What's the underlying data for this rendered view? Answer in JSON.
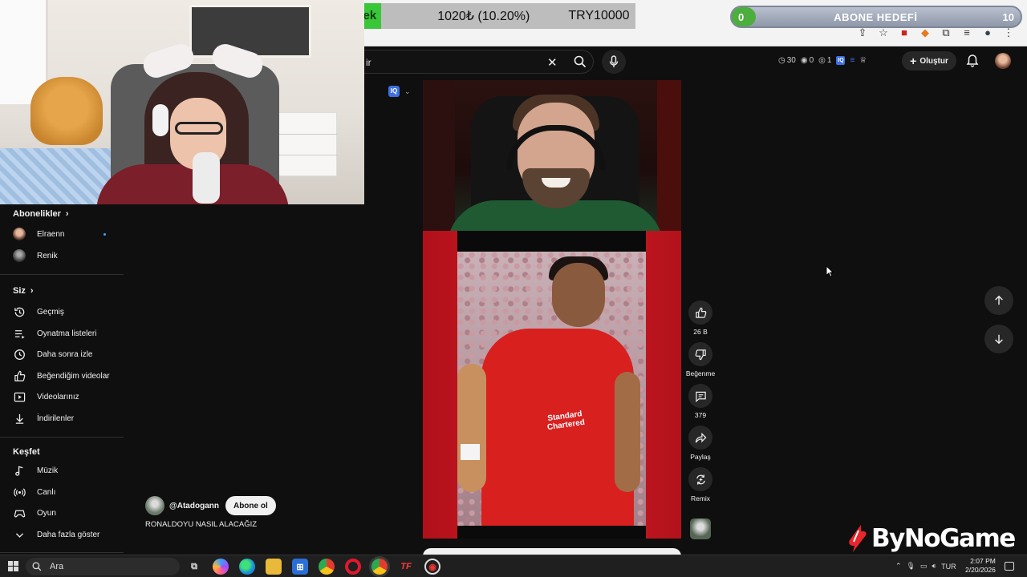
{
  "overlays": {
    "donation": {
      "tag": "Destek",
      "amount": "1020₺ (10.20%)",
      "goal": "TRY10000"
    },
    "sub_goal": {
      "start": "0",
      "label": "ABONE HEDEFİ",
      "end": "10",
      "progress": 0.05
    },
    "watermark": "ByNoGame"
  },
  "search": {
    "query": "ir"
  },
  "stats": {
    "views": "30",
    "watching": "0",
    "other": "1"
  },
  "header": {
    "create_label": "Oluştur"
  },
  "sidebar": {
    "subscriptions_title": "Abonelikler",
    "subscriptions": [
      {
        "label": "Elraenn",
        "new": true
      },
      {
        "label": "Renik",
        "new": false
      }
    ],
    "you_title": "Siz",
    "you_items": [
      {
        "label": "Geçmiş",
        "icon": "history-icon"
      },
      {
        "label": "Oynatma listeleri",
        "icon": "playlist-icon"
      },
      {
        "label": "Daha sonra izle",
        "icon": "clock-icon"
      },
      {
        "label": "Beğendiğim videolar",
        "icon": "thumb-up-icon"
      },
      {
        "label": "Videolarınız",
        "icon": "video-icon"
      },
      {
        "label": "İndirilenler",
        "icon": "download-icon"
      }
    ],
    "explore_title": "Keşfet",
    "explore_items": [
      {
        "label": "Müzik",
        "icon": "music-icon"
      },
      {
        "label": "Canlı",
        "icon": "live-icon"
      },
      {
        "label": "Oyun",
        "icon": "gaming-icon"
      }
    ],
    "show_more": "Daha fazla göster"
  },
  "short": {
    "channel": "@Atadogann",
    "subscribe_label": "Abone ol",
    "title": "RONALDOYU NASIL ALACAĞIZ",
    "iq_label": "IQ"
  },
  "actions": {
    "likes": "26 B",
    "dislike_label": "Beğenme",
    "comments": "379",
    "share_label": "Paylaş",
    "remix_label": "Remix"
  },
  "taskbar": {
    "search_placeholder": "Ara",
    "language": "TUR",
    "time": "2:07 PM",
    "date": "2/20/2026"
  }
}
